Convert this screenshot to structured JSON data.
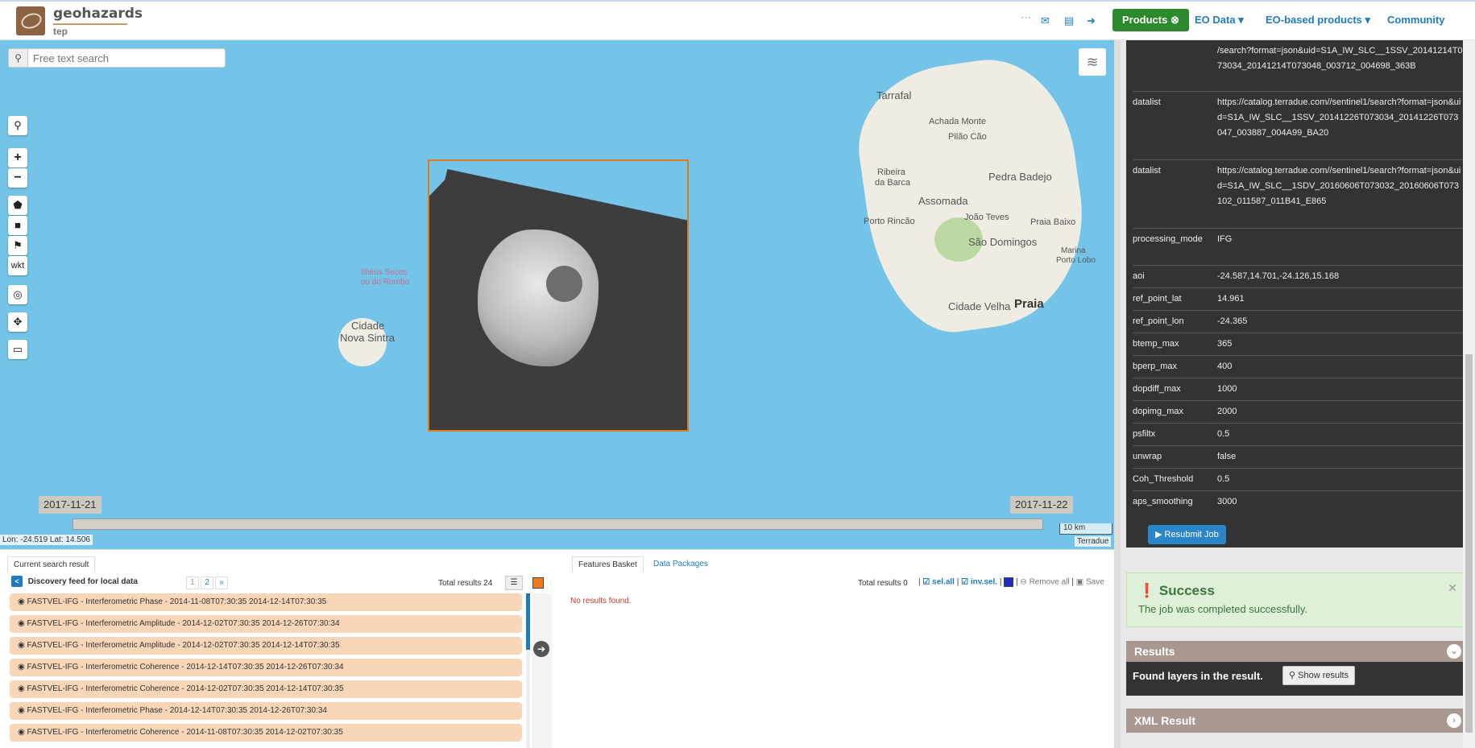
{
  "header": {
    "brand": "geohazards",
    "brand_sub": "tep",
    "icons": [
      "ellipsis-icon",
      "envelope-icon",
      "book-icon",
      "sign-out-icon"
    ],
    "nav": {
      "products": "Products",
      "eo_data": "EO Data",
      "eo_products": "EO-based products",
      "community": "Community"
    }
  },
  "map": {
    "search_placeholder": "Free text search",
    "tools": [
      "search",
      "zoom-in",
      "zoom-out",
      "draw-polygon",
      "draw-box",
      "draw-point",
      "wkt",
      "globe",
      "fullscreen",
      "measure"
    ],
    "wkt_label": "wkt",
    "labels": {
      "tarrafal": "Tarrafal",
      "achada_monte": "Achada Monte",
      "pilao_cao": "Pilão Cão",
      "ribeira_barca_1": "Ribeira",
      "ribeira_barca_2": "da Barca",
      "pedra_badejo": "Pedra Badejo",
      "assomada": "Assomada",
      "joao_teves": "João Teves",
      "porto_rincao": "Porto Rincão",
      "praia_baixo": "Praia Baixo",
      "sao_domingos": "São Domingos",
      "marina": "Marina",
      "porto_lobo": "Porto Lobo",
      "cidade_velha": "Cidade Velha",
      "praia": "Praia",
      "ilheus_1": "Ilhéus Secos",
      "ilheus_2": "ou do Rombo",
      "nova_sintra_1": "Cidade",
      "nova_sintra_2": "Nova Sintra"
    },
    "time_start": "2017-11-21",
    "time_end": "2017-11-22",
    "scale": "10 km",
    "coords": "Lon: -24.519 Lat: 14.506",
    "attribution": "Terradue"
  },
  "search_panel": {
    "tab_current": "Current search result",
    "feed_title": "Discovery feed for local data",
    "pages": [
      "1",
      "2",
      "»"
    ],
    "total": "Total results  24",
    "results": [
      "FASTVEL-IFG - Interferometric Phase - 2014-11-08T07:30:35 2014-12-14T07:30:35",
      "FASTVEL-IFG - Interferometric Amplitude - 2014-12-02T07:30:35 2014-12-26T07:30:34",
      "FASTVEL-IFG - Interferometric Amplitude - 2014-12-02T07:30:35 2014-12-14T07:30:35",
      "FASTVEL-IFG - Interferometric Coherence - 2014-12-14T07:30:35 2014-12-26T07:30:34",
      "FASTVEL-IFG - Interferometric Coherence - 2014-12-02T07:30:35 2014-12-14T07:30:35",
      "FASTVEL-IFG - Interferometric Phase - 2014-12-14T07:30:35 2014-12-26T07:30:34",
      "FASTVEL-IFG - Interferometric Coherence - 2014-11-08T07:30:35 2014-12-02T07:30:35"
    ]
  },
  "basket_panel": {
    "tab_basket": "Features Basket",
    "tab_packages": "Data Packages",
    "total": "Total results  0",
    "sel_all": "sel.all",
    "inv_sel": "inv.sel.",
    "remove_all": "Remove all",
    "save": "Save",
    "no_results": "No results found."
  },
  "job": {
    "params": [
      {
        "key": "",
        "value": "/search?format=json&uid=S1A_IW_SLC__1SSV_20141214T073034_20141214T073048_003712_004698_363B"
      },
      {
        "key": "datalist",
        "value": "https://catalog.terradue.com//sentinel1/search?format=json&uid=S1A_IW_SLC__1SSV_20141226T073034_20141226T073047_003887_004A99_BA20"
      },
      {
        "key": "datalist",
        "value": "https://catalog.terradue.com//sentinel1/search?format=json&uid=S1A_IW_SLC__1SDV_20160606T073032_20160606T073102_011587_011B41_E865"
      },
      {
        "key": "processing_mode",
        "value": "IFG"
      },
      {
        "key": "aoi",
        "value": "-24.587,14.701,-24.126,15.168"
      },
      {
        "key": "ref_point_lat",
        "value": "14.961"
      },
      {
        "key": "ref_point_lon",
        "value": "-24.365"
      },
      {
        "key": "btemp_max",
        "value": "365"
      },
      {
        "key": "bperp_max",
        "value": "400"
      },
      {
        "key": "dopdiff_max",
        "value": "1000"
      },
      {
        "key": "dopimg_max",
        "value": "2000"
      },
      {
        "key": "psfiltx",
        "value": "0.5"
      },
      {
        "key": "unwrap",
        "value": "false"
      },
      {
        "key": "Coh_Threshold",
        "value": "0.5"
      },
      {
        "key": "aps_smoothing",
        "value": "3000"
      }
    ],
    "resubmit": "Resubmit Job",
    "success_title": "Success",
    "success_text": "The job was completed successfully.",
    "results_title": "Results",
    "found_text": "Found layers in the result.",
    "show_results": "Show results",
    "xml_title": "XML Result"
  },
  "colors": {
    "accent": "#1e7bc2",
    "products_green": "#2c8a2c",
    "result_row": "#f9d6b8",
    "panel_dark": "#333333",
    "panel_header": "#a99890",
    "success_bg": "#dff0d8"
  }
}
